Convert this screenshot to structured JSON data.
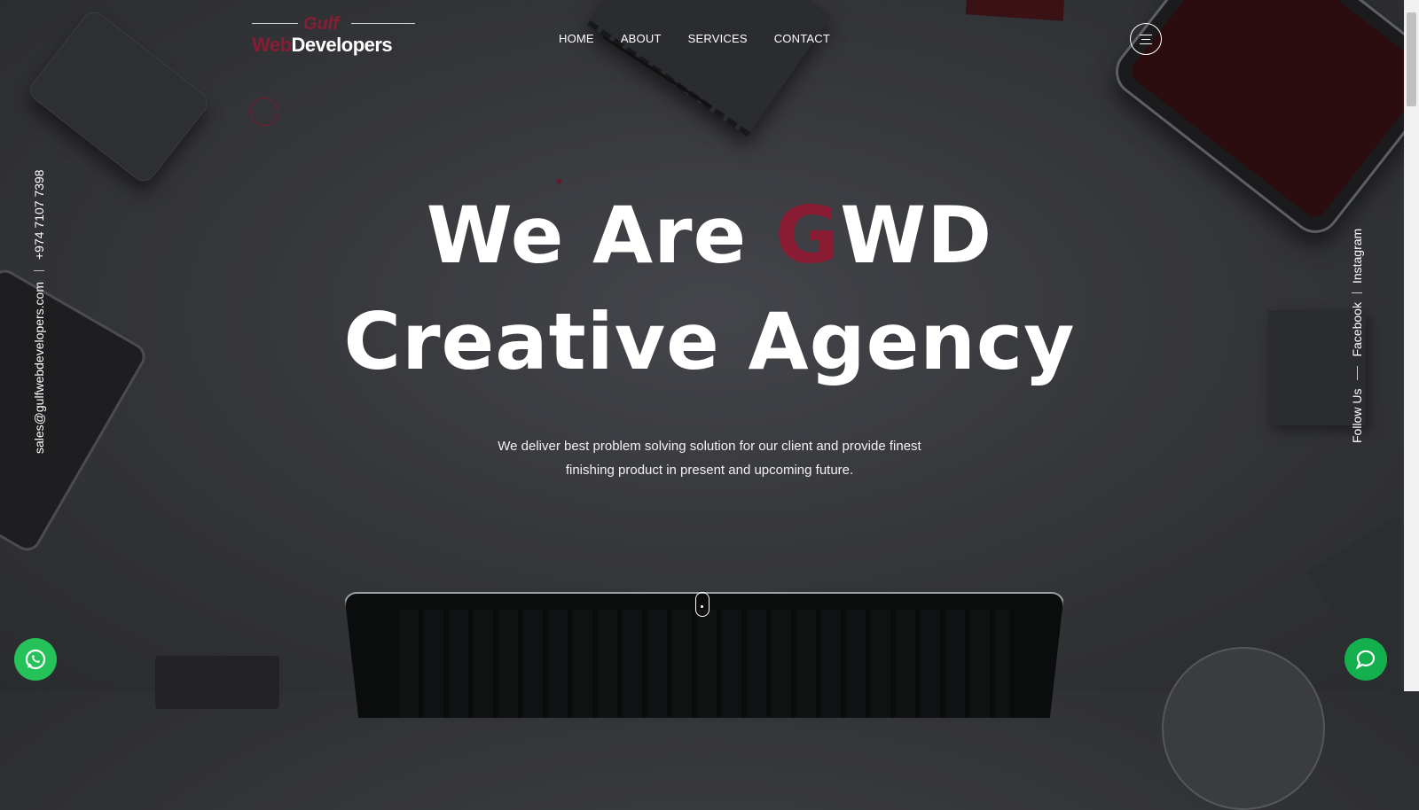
{
  "brand": {
    "top": "Gulf",
    "web": "Web",
    "rest": "Developers"
  },
  "nav": [
    "HOME",
    "ABOUT",
    "SERVICES",
    "CONTACT"
  ],
  "contact": {
    "email": "sales@gulfwebdevelopers.com",
    "phone": "+974 7107 7398"
  },
  "social": {
    "label": "Follow Us",
    "links": [
      "Facebook",
      "Instagram"
    ]
  },
  "hero": {
    "line1_pre": "We Are ",
    "line1_accent": "G",
    "line1_post": "WD",
    "line2": "Creative Agency",
    "subtitle_1": "We deliver best problem solving solution for our client and provide finest",
    "subtitle_2": "finishing product in present and upcoming future."
  },
  "colors": {
    "accent": "#8a1c34",
    "whatsapp": "#25c25a",
    "chat": "#13b04d"
  },
  "icons": [
    "menu-icon",
    "whatsapp-icon",
    "chat-icon",
    "scroll-down-icon"
  ]
}
